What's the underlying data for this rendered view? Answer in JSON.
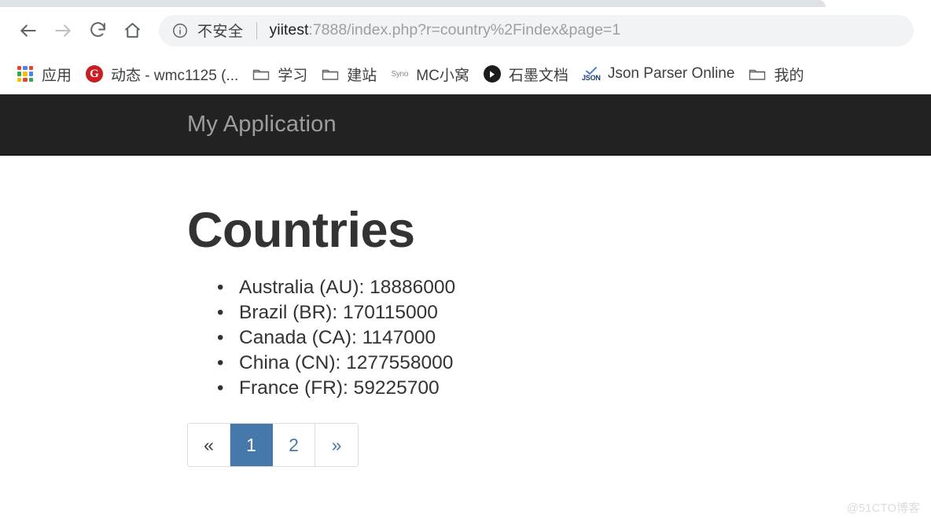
{
  "browser": {
    "nav": {
      "back_title": "Back",
      "forward_title": "Forward",
      "reload_title": "Reload",
      "home_title": "Home"
    },
    "omnibox": {
      "security_label": "不安全",
      "url_host": "yiitest",
      "url_rest": ":7888/index.php?r=country%2Findex&page=1",
      "url_full": "yiitest:7888/index.php?r=country%2Findex&page=1",
      "info_icon": "info-circle-icon"
    },
    "bookmarks": [
      {
        "label": "应用",
        "icon": "apps-grid-icon"
      },
      {
        "label": "动态 - wmc1125 (...",
        "icon": "gitee-logo-icon"
      },
      {
        "label": "学习",
        "icon": "folder-icon"
      },
      {
        "label": "建站",
        "icon": "folder-icon"
      },
      {
        "label": "MC小窝",
        "icon": "synology-icon"
      },
      {
        "label": "石墨文档",
        "icon": "shimo-logo-icon"
      },
      {
        "label": "Json Parser Online",
        "icon": "json-check-icon"
      },
      {
        "label": "我的",
        "icon": "folder-icon"
      }
    ]
  },
  "page": {
    "navbar": {
      "brand": "My Application"
    },
    "title": "Countries",
    "countries": [
      "Australia (AU): 18886000",
      "Brazil (BR): 170115000",
      "Canada (CA): 1147000",
      "China (CN): 1277558000",
      "France (FR): 59225700"
    ],
    "pagination": {
      "first": "«",
      "pages": [
        "1",
        "2"
      ],
      "active_page": "1",
      "last": "»"
    }
  },
  "watermark": "@51CTO博客",
  "colors": {
    "navbar_bg": "#222222",
    "brand_text": "#9d9d9d",
    "link_blue": "#4579ac",
    "active_page_bg": "#4579ac",
    "heading": "#333333",
    "omnibox_bg": "#f1f3f4"
  }
}
